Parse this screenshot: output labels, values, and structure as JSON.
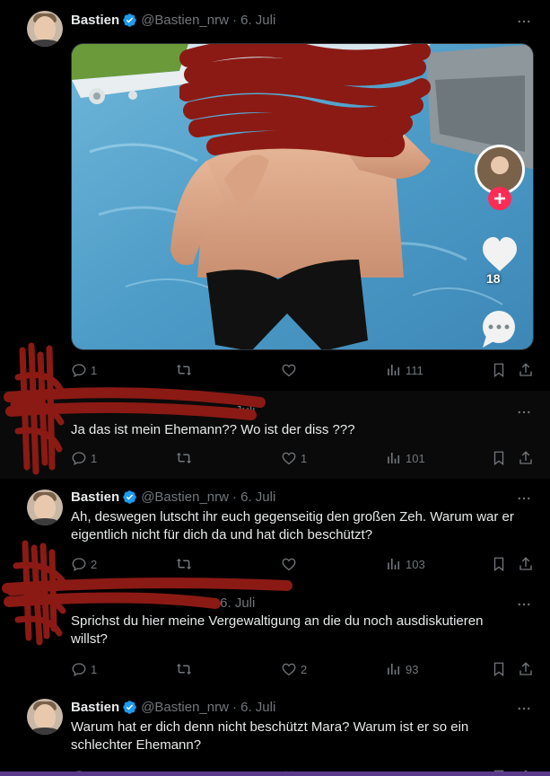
{
  "tweets": [
    {
      "name": "Bastien",
      "handle": "@Bastien_nrw",
      "date": "· 6. Juli",
      "text": "",
      "stats": {
        "reply": "1",
        "retweet": "",
        "like": "",
        "views": "111"
      }
    },
    {
      "name": "",
      "handle": "",
      "date": "Juli",
      "text": "Ja das ist mein Ehemann?? Wo ist der diss ???",
      "stats": {
        "reply": "1",
        "retweet": "",
        "like": "1",
        "views": "101"
      }
    },
    {
      "name": "Bastien",
      "handle": "@Bastien_nrw",
      "date": "· 6. Juli",
      "text": "Ah, deswegen lutscht ihr euch gegenseitig den großen Zeh. Warum war er eigentlich nicht für dich da und hat dich beschützt?",
      "stats": {
        "reply": "2",
        "retweet": "",
        "like": "",
        "views": "103"
      }
    },
    {
      "name": "",
      "handle": "",
      "date": "· 6. Juli",
      "text": "Sprichst du hier meine Vergewaltigung an die du noch ausdiskutieren willst?",
      "stats": {
        "reply": "1",
        "retweet": "",
        "like": "2",
        "views": "93"
      }
    },
    {
      "name": "Bastien",
      "handle": "@Bastien_nrw",
      "date": "· 6. Juli",
      "text": "Warum hat er dich denn nicht beschützt Mara? Warum ist er so ein schlechter Ehemann?",
      "stats": {
        "reply": "",
        "retweet": "",
        "like": "",
        "views": ""
      }
    }
  ],
  "media": {
    "like_count": "18"
  },
  "colors": {
    "background": "#000000",
    "text": "#e7e9ea",
    "muted": "#71767b",
    "verified": "#1d9bf0",
    "redaction": "#8b1a14",
    "plus_button": "#fe2c55"
  },
  "icons": [
    "verified-badge-icon",
    "more-icon",
    "reply-icon",
    "retweet-icon",
    "like-icon",
    "views-icon",
    "bookmark-icon",
    "share-icon",
    "heart-icon",
    "comments-icon",
    "plus-icon"
  ]
}
